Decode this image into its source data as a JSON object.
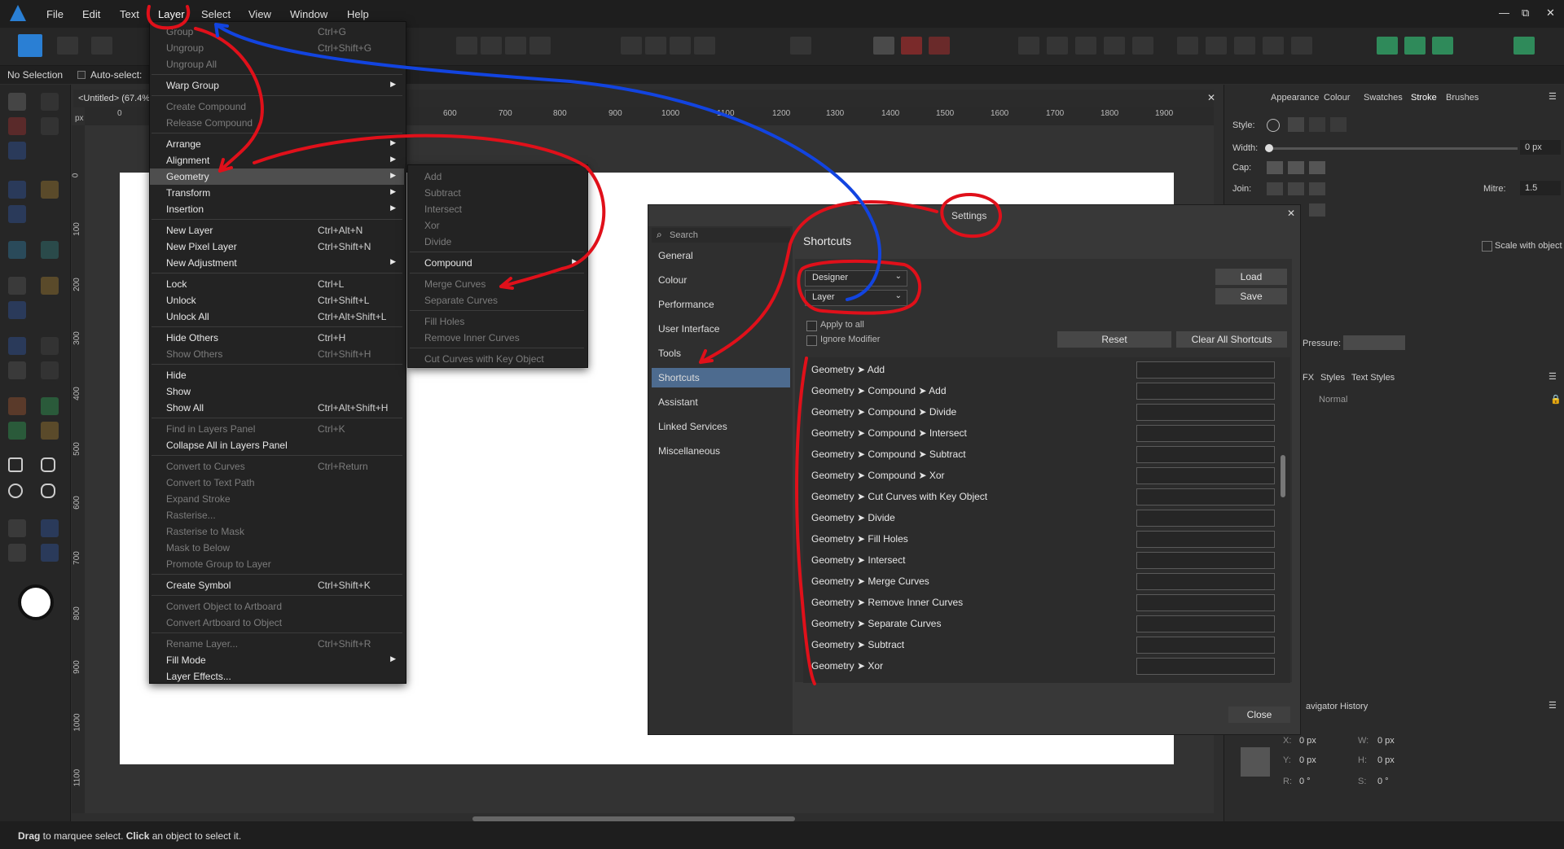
{
  "menubar": {
    "items": [
      "File",
      "Edit",
      "Text",
      "Layer",
      "Select",
      "View",
      "Window",
      "Help"
    ],
    "active": "Layer"
  },
  "window_controls": [
    "—",
    "⧉",
    "✕"
  ],
  "context": {
    "selection": "No Selection",
    "auto_select": "Auto-select:"
  },
  "document": {
    "tab_title": "<Untitled> (67.4%)",
    "ruler_unit": "px",
    "ruler_top": [
      "0",
      "600",
      "700",
      "800",
      "900",
      "1000",
      "1100",
      "1200",
      "1300",
      "1400",
      "1500",
      "1600",
      "1700",
      "1800",
      "1900"
    ],
    "ruler_left": [
      "0",
      "100",
      "200",
      "300",
      "400",
      "500",
      "600",
      "700",
      "800",
      "900",
      "1000",
      "1100"
    ]
  },
  "layer_menu": {
    "items": [
      {
        "label": "Group",
        "shortcut": "Ctrl+G",
        "disabled": true
      },
      {
        "label": "Ungroup",
        "shortcut": "Ctrl+Shift+G",
        "disabled": true
      },
      {
        "label": "Ungroup All",
        "shortcut": "",
        "disabled": true
      },
      {
        "label": "Warp Group",
        "shortcut": "",
        "disabled": false,
        "submenu": true
      },
      {
        "label": "Create Compound",
        "shortcut": "",
        "disabled": true
      },
      {
        "label": "Release Compound",
        "shortcut": "",
        "disabled": true
      },
      {
        "label": "Arrange",
        "shortcut": "",
        "disabled": false,
        "submenu": true
      },
      {
        "label": "Alignment",
        "shortcut": "",
        "disabled": false,
        "submenu": true
      },
      {
        "label": "Geometry",
        "shortcut": "",
        "disabled": false,
        "submenu": true,
        "highlighted": true
      },
      {
        "label": "Transform",
        "shortcut": "",
        "disabled": false,
        "submenu": true
      },
      {
        "label": "Insertion",
        "shortcut": "",
        "disabled": false,
        "submenu": true
      },
      {
        "label": "New Layer",
        "shortcut": "Ctrl+Alt+N",
        "disabled": false
      },
      {
        "label": "New Pixel Layer",
        "shortcut": "Ctrl+Shift+N",
        "disabled": false
      },
      {
        "label": "New Adjustment",
        "shortcut": "",
        "disabled": false,
        "submenu": true
      },
      {
        "label": "Lock",
        "shortcut": "Ctrl+L",
        "disabled": false
      },
      {
        "label": "Unlock",
        "shortcut": "Ctrl+Shift+L",
        "disabled": false
      },
      {
        "label": "Unlock All",
        "shortcut": "Ctrl+Alt+Shift+L",
        "disabled": false
      },
      {
        "label": "Hide Others",
        "shortcut": "Ctrl+H",
        "disabled": false
      },
      {
        "label": "Show Others",
        "shortcut": "Ctrl+Shift+H",
        "disabled": true
      },
      {
        "label": "Hide",
        "shortcut": "",
        "disabled": false
      },
      {
        "label": "Show",
        "shortcut": "",
        "disabled": false
      },
      {
        "label": "Show All",
        "shortcut": "Ctrl+Alt+Shift+H",
        "disabled": false
      },
      {
        "label": "Find in Layers Panel",
        "shortcut": "Ctrl+K",
        "disabled": true
      },
      {
        "label": "Collapse All in Layers Panel",
        "shortcut": "",
        "disabled": false
      },
      {
        "label": "Convert to Curves",
        "shortcut": "Ctrl+Return",
        "disabled": true
      },
      {
        "label": "Convert to Text Path",
        "shortcut": "",
        "disabled": true
      },
      {
        "label": "Expand Stroke",
        "shortcut": "",
        "disabled": true
      },
      {
        "label": "Rasterise...",
        "shortcut": "",
        "disabled": true
      },
      {
        "label": "Rasterise to Mask",
        "shortcut": "",
        "disabled": true
      },
      {
        "label": "Mask to Below",
        "shortcut": "",
        "disabled": true
      },
      {
        "label": "Promote Group to Layer",
        "shortcut": "",
        "disabled": true
      },
      {
        "label": "Create Symbol",
        "shortcut": "Ctrl+Shift+K",
        "disabled": false
      },
      {
        "label": "Convert Object to Artboard",
        "shortcut": "",
        "disabled": true
      },
      {
        "label": "Convert Artboard to Object",
        "shortcut": "",
        "disabled": true
      },
      {
        "label": "Rename Layer...",
        "shortcut": "Ctrl+Shift+R",
        "disabled": true
      },
      {
        "label": "Fill Mode",
        "shortcut": "",
        "disabled": false,
        "submenu": true
      },
      {
        "label": "Layer Effects...",
        "shortcut": "",
        "disabled": false
      }
    ]
  },
  "geometry_menu": {
    "items": [
      {
        "label": "Add",
        "disabled": true
      },
      {
        "label": "Subtract",
        "disabled": true
      },
      {
        "label": "Intersect",
        "disabled": true
      },
      {
        "label": "Xor",
        "disabled": true
      },
      {
        "label": "Divide",
        "disabled": true
      },
      {
        "label": "Compound",
        "disabled": false,
        "submenu": true
      },
      {
        "label": "Merge Curves",
        "disabled": true
      },
      {
        "label": "Separate Curves",
        "disabled": true
      },
      {
        "label": "Fill Holes",
        "disabled": true
      },
      {
        "label": "Remove Inner Curves",
        "disabled": true
      },
      {
        "label": "Cut Curves with Key Object",
        "disabled": true
      }
    ]
  },
  "right_panel": {
    "tabs": [
      "Appearance",
      "Colour",
      "Swatches",
      "Stroke",
      "Brushes"
    ],
    "active_tab": "Stroke",
    "style_label": "Style:",
    "width_label": "Width:",
    "width_value": "0 px",
    "cap_label": "Cap:",
    "join_label": "Join:",
    "mitre_label": "Mitre:",
    "mitre_value": "1.5",
    "scale_with_object": "Scale with object",
    "pressure_label": "Pressure:",
    "fx_tabs": [
      "FX",
      "Styles",
      "Text Styles"
    ],
    "blend_mode": "Normal",
    "nav_tabs": [
      "avigator",
      "History"
    ],
    "transform": {
      "x_label": "X:",
      "x_value": "0 px",
      "y_label": "Y:",
      "y_value": "0 px",
      "w_label": "W:",
      "w_value": "0 px",
      "h_label": "H:",
      "h_value": "0 px",
      "r_label": "R:",
      "r_value": "0 °",
      "s_label": "S:",
      "s_value": "0 °"
    }
  },
  "settings_dialog": {
    "title": "Settings",
    "search_placeholder": "Search",
    "sidebar": [
      "General",
      "Colour",
      "Performance",
      "User Interface",
      "Tools",
      "Shortcuts",
      "Assistant",
      "Linked Services",
      "Miscellaneous"
    ],
    "selected": "Shortcuts",
    "heading": "Shortcuts",
    "dropdown_app": "Designer",
    "dropdown_category": "Layer",
    "load_label": "Load",
    "save_label": "Save",
    "apply_to_all": "Apply to all",
    "ignore_modifier": "Ignore Modifier",
    "reset_label": "Reset",
    "clear_all_label": "Clear All Shortcuts",
    "close_label": "Close",
    "shortcuts": [
      "Geometry ➤ Add",
      "Geometry ➤ Compound ➤ Add",
      "Geometry ➤ Compound ➤ Divide",
      "Geometry ➤ Compound ➤ Intersect",
      "Geometry ➤ Compound ➤ Subtract",
      "Geometry ➤ Compound ➤ Xor",
      "Geometry ➤ Cut Curves with Key Object",
      "Geometry ➤ Divide",
      "Geometry ➤ Fill Holes",
      "Geometry ➤ Intersect",
      "Geometry ➤ Merge Curves",
      "Geometry ➤ Remove Inner Curves",
      "Geometry ➤ Separate Curves",
      "Geometry ➤ Subtract",
      "Geometry ➤ Xor"
    ]
  },
  "status": {
    "drag": "Drag",
    "drag_text": " to marquee select. ",
    "click": "Click",
    "click_text": " an object to select it."
  },
  "colors": {
    "accent": "#4d6b8f",
    "scribble_red": "#e0101a",
    "scribble_blue": "#1244e0"
  }
}
